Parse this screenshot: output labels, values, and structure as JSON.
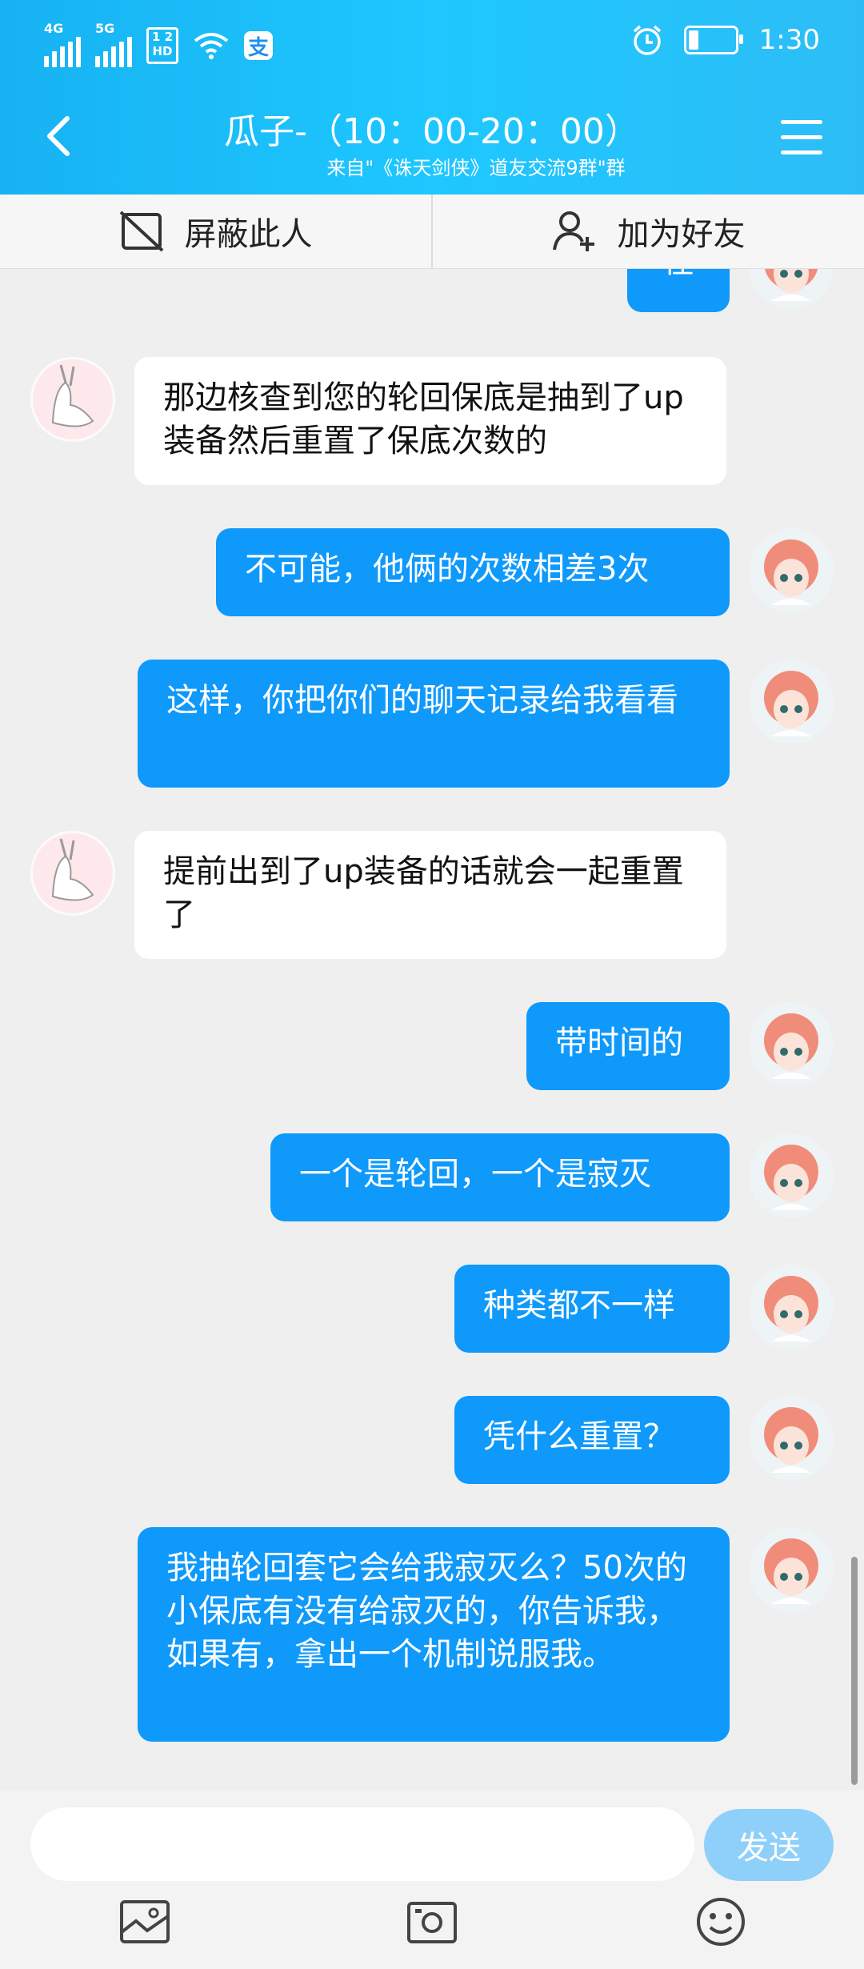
{
  "status_bar": {
    "net1": "4G",
    "net2": "5G",
    "hd": "1 2\nHD",
    "pay_glyph": "支",
    "time": "1:30"
  },
  "header": {
    "title": "瓜子-（10：00-20：00）",
    "subtitle": "来自\"《诛天剑侠》道友交流9群\"群",
    "accent": "#1ec7ff"
  },
  "actions": {
    "block": "屏蔽此人",
    "add_friend": "加为好友"
  },
  "messages": [
    {
      "side": "out",
      "text": "在"
    },
    {
      "side": "in",
      "text": "那边核查到您的轮回保底是抽到了up装备然后重置了保底次数的"
    },
    {
      "side": "out",
      "text": "不可能，他俩的次数相差3次"
    },
    {
      "side": "out",
      "text": "这样，你把你们的聊天记录给我看看"
    },
    {
      "side": "in",
      "text": "提前出到了up装备的话就会一起重置了"
    },
    {
      "side": "out",
      "text": "带时间的"
    },
    {
      "side": "out",
      "text": "一个是轮回，一个是寂灭"
    },
    {
      "side": "out",
      "text": "种类都不一样"
    },
    {
      "side": "out",
      "text": "凭什么重置？"
    },
    {
      "side": "out",
      "text": "我抽轮回套它会给我寂灭么？50次的小保底有没有给寂灭的，你告诉我，如果有，拿出一个机制说服我。"
    }
  ],
  "composer": {
    "input_value": "",
    "send_label": "发送"
  },
  "toolbar_icons": [
    "image-icon",
    "camera-icon",
    "emoji-icon"
  ],
  "colors": {
    "outgoing_bubble": "#0e99fb",
    "incoming_bubble": "#ffffff",
    "send_button": "#8ed0fa"
  }
}
